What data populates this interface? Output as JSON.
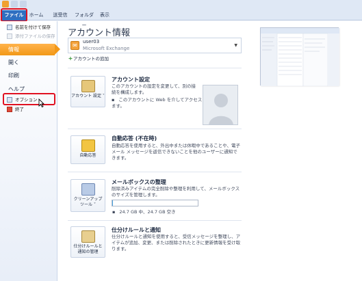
{
  "tabs": {
    "file": "ファイル",
    "home": "ホーム",
    "send_receive": "送受信",
    "folder": "フォルダー",
    "view": "表示"
  },
  "nav": {
    "save_as": "名前を付けて保存",
    "save_attachments": "添付ファイルの保存",
    "info": "情報",
    "open": "開く",
    "print": "印刷",
    "help": "ヘルプ",
    "options": "オプション",
    "exit": "終了"
  },
  "main": {
    "title": "アカウント情報",
    "account": {
      "name": "user03",
      "type": "Microsoft Exchange"
    },
    "add_account": "アカウントの追加",
    "sections": {
      "account_settings": {
        "button_label": "アカウント 設定 ˅",
        "title": "アカウント設定",
        "desc": "このアカウントの設定を変更して、別の接続を構成します。",
        "bullet": "このアカウントに Web を介してアクセスします。"
      },
      "auto_reply": {
        "button_label": "自動応答",
        "title": "自動応答 (不在時)",
        "desc": "自動応答を使用すると、外出中または休暇中であることや、電子メール メッセージを返信できないことを他のユーザーに通知できます。"
      },
      "mailbox_cleanup": {
        "button_label": "クリーンアップ ツール ˅",
        "title": "メールボックスの整理",
        "desc": "削除済みアイテムの完全削除や整理を利用して、メールボックスのサイズを管理します。",
        "quota": "24.7 GB 中、24.7 GB 空き",
        "used_fraction": 0.01
      },
      "rules_alerts": {
        "button_label": "仕分けルールと 通知の管理",
        "title": "仕分けルールと通知",
        "desc": "仕分けルールと通知を使用すると、受信メッセージを整理し、アイテムが追加、変更、または削除されたときに更新情報を受け取ります。"
      }
    }
  },
  "colors": {
    "accent_file_tab": "#2f6fc1",
    "active_nav": "#f29818",
    "highlight": "#e01020"
  }
}
